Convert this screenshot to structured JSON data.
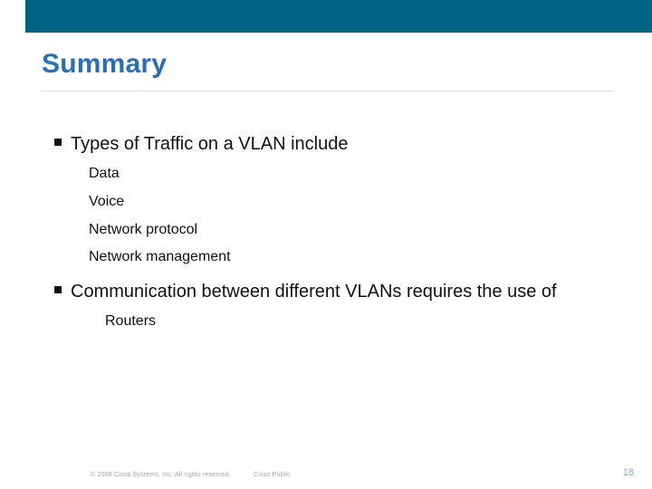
{
  "header": {
    "title": "Summary"
  },
  "bullets": [
    {
      "text": "Types of Traffic on a VLAN include",
      "subitems": [
        "Data",
        "Voice",
        "Network protocol",
        "Network management"
      ],
      "sub_indent": "normal"
    },
    {
      "text": "Communication between different VLANs requires the use of",
      "subitems": [
        "Routers"
      ],
      "sub_indent": "extra"
    }
  ],
  "footer": {
    "copyright": "© 2006 Cisco Systems, Inc. All rights reserved.",
    "classification": "Cisco Public",
    "page_number": "18"
  }
}
